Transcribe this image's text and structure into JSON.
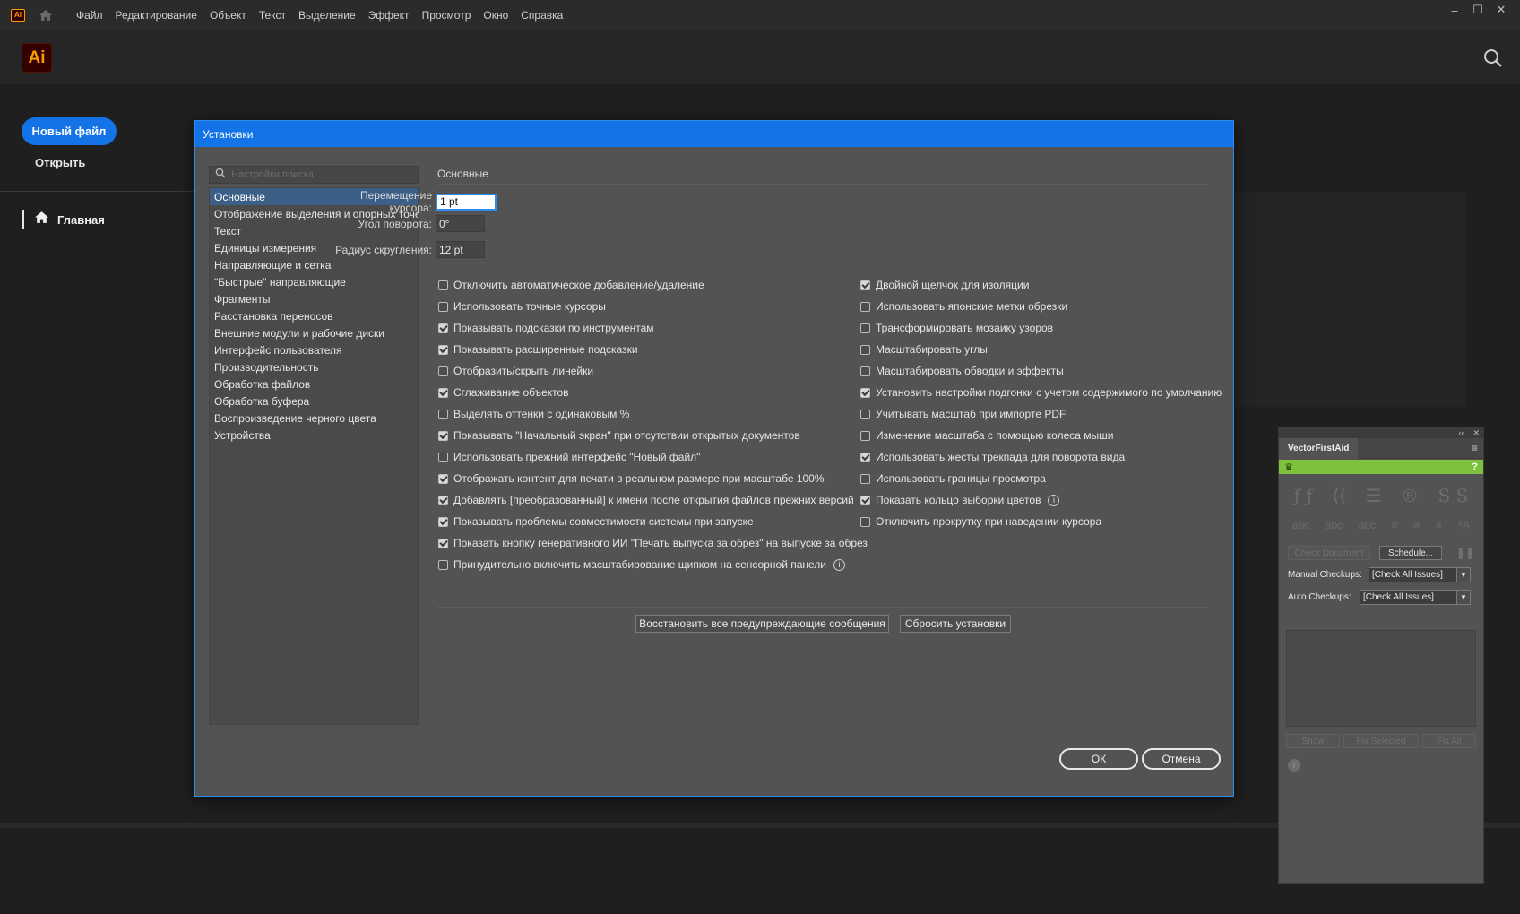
{
  "menubar": {
    "app_badge": "Ai",
    "items": [
      "Файл",
      "Редактирование",
      "Объект",
      "Текст",
      "Выделение",
      "Эффект",
      "Просмотр",
      "Окно",
      "Справка"
    ],
    "window_controls": [
      "–",
      "☐",
      "✕"
    ]
  },
  "home": {
    "logo": "Ai",
    "new_file": "Новый файл",
    "open": "Открыть",
    "home_nav": "Главная"
  },
  "dialog": {
    "title": "Установки",
    "search_placeholder": "Настройки поиска",
    "categories": [
      "Основные",
      "Отображение выделения и опорных точек",
      "Текст",
      "Единицы измерения",
      "Направляющие и сетка",
      "\"Быстрые\" направляющие",
      "Фрагменты",
      "Расстановка переносов",
      "Внешние модули и рабочие диски",
      "Интерфейс пользователя",
      "Производительность",
      "Обработка файлов",
      "Обработка буфера",
      "Воспроизведение черного цвета",
      "Устройства"
    ],
    "section_title": "Основные",
    "fields": {
      "cursor_move_label": "Перемещение курсора:",
      "cursor_move_value": "1 pt",
      "rotate_label": "Угол поворота:",
      "rotate_value": "0°",
      "radius_label": "Радиус скругления:",
      "radius_value": "12 pt"
    },
    "checks_left": [
      {
        "label": "Отключить автоматическое добавление/удаление",
        "checked": false
      },
      {
        "label": "Использовать точные курсоры",
        "checked": false
      },
      {
        "label": "Показывать подсказки по инструментам",
        "checked": true
      },
      {
        "label": "Показывать расширенные подсказки",
        "checked": true
      },
      {
        "label": "Отобразить/скрыть линейки",
        "checked": false
      },
      {
        "label": "Сглаживание объектов",
        "checked": true
      },
      {
        "label": "Выделять оттенки с одинаковым %",
        "checked": false
      },
      {
        "label": "Показывать \"Начальный экран\" при отсутствии открытых документов",
        "checked": true
      },
      {
        "label": "Использовать прежний интерфейс \"Новый файл\"",
        "checked": false
      },
      {
        "label": "Отображать контент для печати в реальном размере при масштабе 100%",
        "checked": true
      },
      {
        "label": "Добавлять [преобразованный] к имени после открытия файлов прежних версий",
        "checked": true
      },
      {
        "label": "Показывать проблемы совместимости системы при запуске",
        "checked": true
      },
      {
        "label": "Показать кнопку генеративного ИИ \"Печать выпуска за обрез\" на выпуске за обрез",
        "checked": true
      },
      {
        "label": "Принудительно включить масштабирование щипком на сенсорной панели",
        "checked": false,
        "info": "i"
      }
    ],
    "checks_right": [
      {
        "label": "Двойной щелчок для изоляции",
        "checked": true
      },
      {
        "label": "Использовать японские метки обрезки",
        "checked": false
      },
      {
        "label": "Трансформировать мозаику узоров",
        "checked": false
      },
      {
        "label": "Масштабировать углы",
        "checked": false
      },
      {
        "label": "Масштабировать обводки и эффекты",
        "checked": false
      },
      {
        "label": "Установить настройки подгонки с учетом содержимого по умолчанию",
        "checked": true
      },
      {
        "label": "Учитывать масштаб при импорте PDF",
        "checked": false
      },
      {
        "label": "Изменение масштаба с помощью колеса мыши",
        "checked": false
      },
      {
        "label": "Использовать жесты трекпада для поворота вида",
        "checked": true
      },
      {
        "label": "Использовать границы просмотра",
        "checked": false
      },
      {
        "label": "Показать кольцо выборки цветов",
        "checked": true,
        "info": "i"
      },
      {
        "label": "Отключить прокрутку при наведении курсора",
        "checked": false
      }
    ],
    "restore_warnings": "Восстановить все предупреждающие сообщения",
    "reset_prefs": "Сбросить установки",
    "ok": "ОК",
    "cancel": "Отмена"
  },
  "vfa": {
    "collapse": "‹‹",
    "close": "✕",
    "tab": "VectorFirstAid",
    "help": "?",
    "check_document": "Check Document",
    "schedule": "Schedule...",
    "manual_label": "Manual Checkups:",
    "manual_value": "[Check All Issues]",
    "auto_label": "Auto Checkups:",
    "auto_value": "[Check All Issues]",
    "show": "Show",
    "fix_selected": "Fix Selected",
    "fix_all": "Fix All",
    "info": "i"
  },
  "colors": {
    "accent": "#1473e6",
    "dialog_bg": "#535353",
    "vfa_green": "#7ec13d"
  }
}
